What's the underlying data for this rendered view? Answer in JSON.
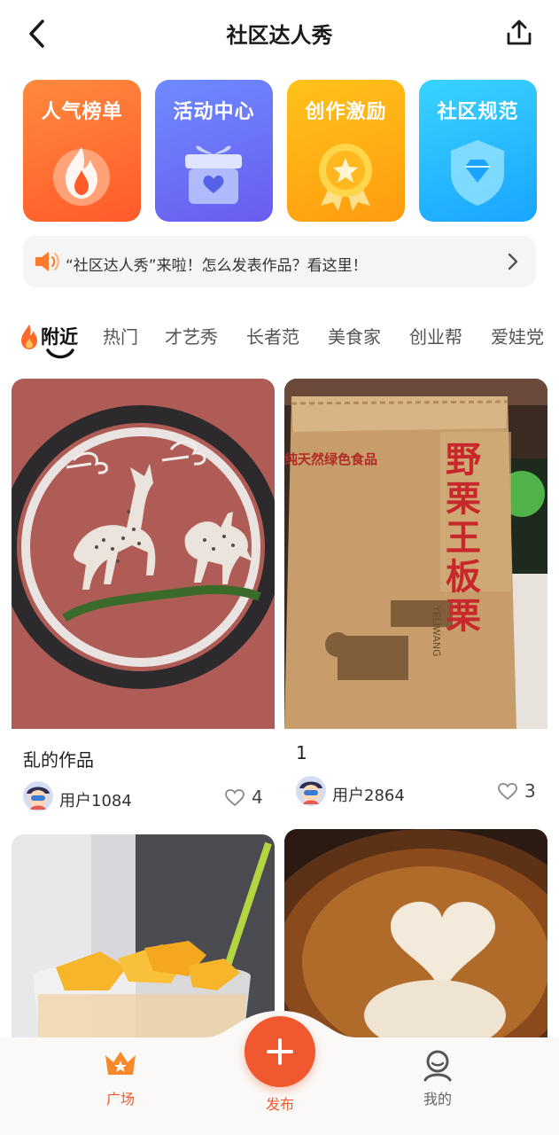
{
  "header": {
    "title": "社区达人秀",
    "back_icon": "chevron-left-icon",
    "share_icon": "share-upload-icon"
  },
  "feature_cards": [
    {
      "label": "人气榜单",
      "icon": "flame-icon",
      "color": "#ff6a2e"
    },
    {
      "label": "活动中心",
      "icon": "gift-box-icon",
      "color": "#6a74f5"
    },
    {
      "label": "创作激励",
      "icon": "star-medal-icon",
      "color": "#ffae14"
    },
    {
      "label": "社区规范",
      "icon": "diamond-shield-icon",
      "color": "#26b8ff"
    }
  ],
  "notice": {
    "text": "“社区达人秀”来啦！怎么发表作品？看这里！",
    "icon": "speaker-icon"
  },
  "tabs": [
    {
      "label": "附近",
      "active": true
    },
    {
      "label": "热门",
      "active": false
    },
    {
      "label": "才艺秀",
      "active": false
    },
    {
      "label": "长者范",
      "active": false
    },
    {
      "label": "美食家",
      "active": false
    },
    {
      "label": "创业帮",
      "active": false
    },
    {
      "label": "爱娃党",
      "active": false
    }
  ],
  "posts": [
    {
      "title": "乱的作品",
      "user": "用户1084",
      "likes": "4",
      "image": "chalk-deer-drawing"
    },
    {
      "title": "1",
      "user": "用户2864",
      "likes": "3",
      "image": "chestnut-paper-bag"
    },
    {
      "title": "",
      "user": "",
      "likes": "",
      "image": "mango-drink-cup"
    },
    {
      "title": "",
      "user": "",
      "likes": "",
      "image": "latte-art-coffee"
    }
  ],
  "chestnut_bag": {
    "brand": "野栗王板栗",
    "slogan": "纯天然绿色食品",
    "pinyin": "YELIWANG"
  },
  "bottom_nav": {
    "plaza": "广场",
    "publish": "发布",
    "mine": "我的",
    "accent": "#f0592f"
  }
}
